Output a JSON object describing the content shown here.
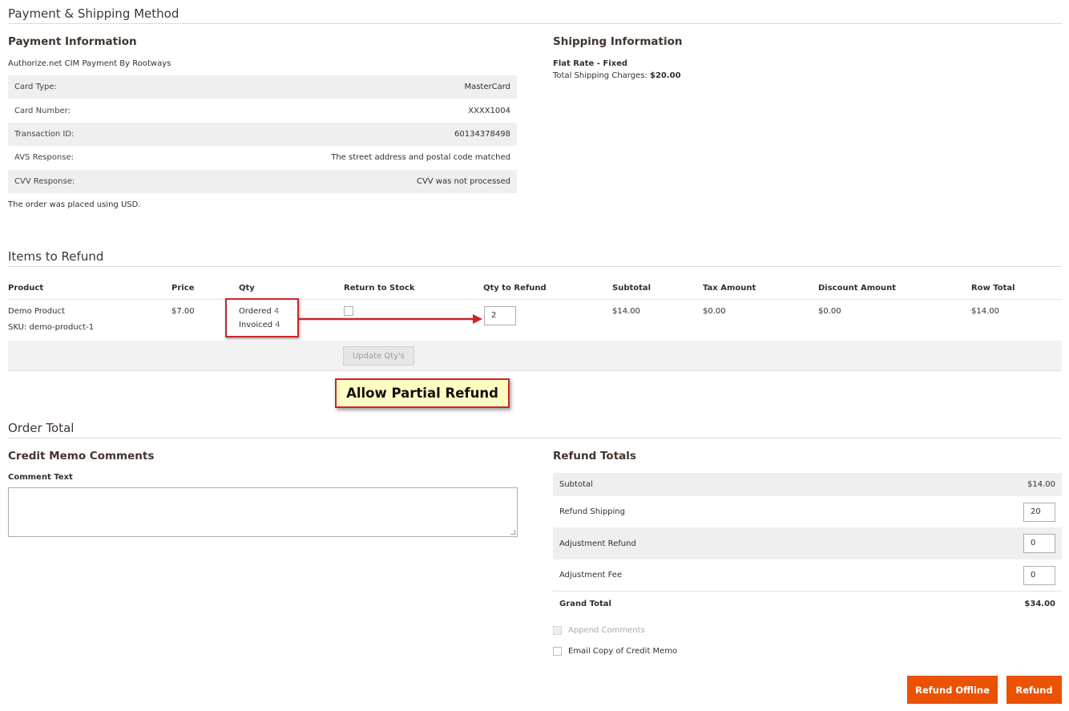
{
  "payment_shipping": {
    "section_title": "Payment & Shipping Method",
    "payment": {
      "title": "Payment Information",
      "method": "Authorize.net CIM Payment By Rootways",
      "rows": [
        {
          "label": "Card Type:",
          "value": "MasterCard"
        },
        {
          "label": "Card Number:",
          "value": "XXXX1004"
        },
        {
          "label": "Transaction ID:",
          "value": "60134378498"
        },
        {
          "label": "AVS Response:",
          "value": "The street address and postal code matched"
        },
        {
          "label": "CVV Response:",
          "value": "CVV was not processed"
        }
      ],
      "currency_note": "The order was placed using USD."
    },
    "shipping": {
      "title": "Shipping Information",
      "method": "Flat Rate - Fixed",
      "charges_label": "Total Shipping Charges:",
      "charges_value": "$20.00"
    }
  },
  "items": {
    "section_title": "Items to Refund",
    "columns": [
      "Product",
      "Price",
      "Qty",
      "Return to Stock",
      "Qty to Refund",
      "Subtotal",
      "Tax Amount",
      "Discount Amount",
      "Row Total"
    ],
    "rows": [
      {
        "product": "Demo Product",
        "sku": "SKU: demo-product-1",
        "price": "$7.00",
        "ordered_label": "Ordered",
        "ordered_qty": "4",
        "invoiced_label": "Invoiced",
        "invoiced_qty": "4",
        "qty_to_refund": "2",
        "subtotal": "$14.00",
        "tax": "$0.00",
        "discount": "$0.00",
        "row_total": "$14.00"
      }
    ],
    "update_button": "Update Qty's"
  },
  "annotation": {
    "label": "Allow Partial Refund"
  },
  "order_total": {
    "section_title": "Order Total",
    "comments": {
      "title": "Credit Memo Comments",
      "field_label": "Comment Text",
      "value": ""
    },
    "refund_totals": {
      "title": "Refund Totals",
      "subtotal_label": "Subtotal",
      "subtotal_value": "$14.00",
      "refund_shipping_label": "Refund Shipping",
      "refund_shipping_value": "20",
      "adjustment_refund_label": "Adjustment Refund",
      "adjustment_refund_value": "0",
      "adjustment_fee_label": "Adjustment Fee",
      "adjustment_fee_value": "0",
      "grand_total_label": "Grand Total",
      "grand_total_value": "$34.00"
    },
    "options": {
      "append_comments": "Append Comments",
      "email_copy": "Email Copy of Credit Memo"
    },
    "buttons": {
      "refund_offline": "Refund Offline",
      "refund": "Refund"
    }
  },
  "colors": {
    "accent": "#eb5202",
    "annotation_border": "#c8262a",
    "annotation_fill": "#fffdc2"
  }
}
